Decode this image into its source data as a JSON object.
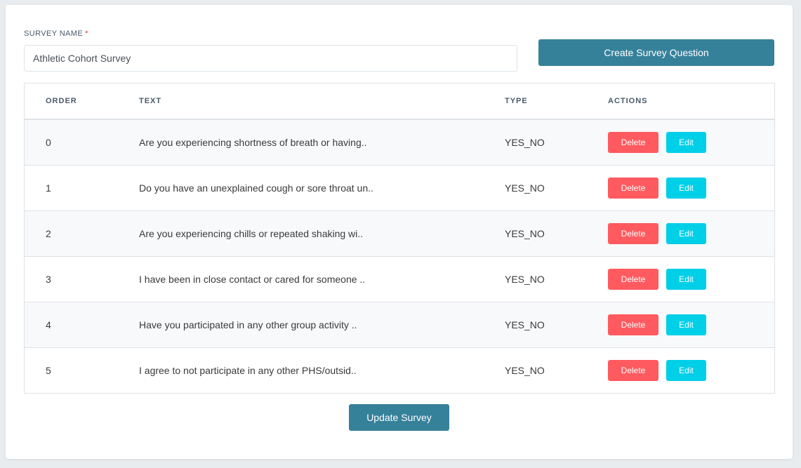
{
  "form": {
    "survey_name_label": "SURVEY NAME",
    "required_mark": "*",
    "survey_name_value": "Athletic Cohort Survey",
    "create_button": "Create Survey Question",
    "update_button": "Update Survey"
  },
  "table": {
    "headers": {
      "order": "ORDER",
      "text": "TEXT",
      "type": "TYPE",
      "actions": "ACTIONS"
    },
    "delete_label": "Delete",
    "edit_label": "Edit",
    "rows": [
      {
        "order": "0",
        "text": "Are you experiencing shortness of breath or having..",
        "type": "YES_NO"
      },
      {
        "order": "1",
        "text": "Do you have an unexplained cough or sore throat un..",
        "type": "YES_NO"
      },
      {
        "order": "2",
        "text": "Are you experiencing chills or repeated shaking wi..",
        "type": "YES_NO"
      },
      {
        "order": "3",
        "text": "I have been in close contact or cared for someone ..",
        "type": "YES_NO"
      },
      {
        "order": "4",
        "text": "Have you participated in any other group activity ..",
        "type": "YES_NO"
      },
      {
        "order": "5",
        "text": "I agree to not participate in any other PHS/outsid..",
        "type": "YES_NO"
      }
    ]
  },
  "colors": {
    "primary": "#36819a",
    "delete": "#ff5a5f",
    "edit": "#00cfe8"
  }
}
